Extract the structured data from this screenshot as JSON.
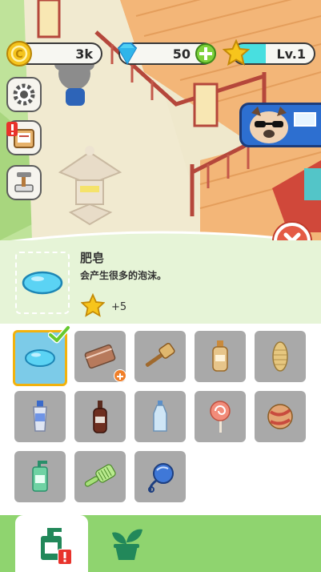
{
  "hud": {
    "coins": "3k",
    "gems": "50",
    "level": "Lv.1",
    "icons": [
      "coin-icon",
      "diamond-icon",
      "plus-icon",
      "star-icon"
    ]
  },
  "sidebar": {
    "buttons": [
      "settings-gear-icon",
      "task-board-icon",
      "build-hammer-icon"
    ]
  },
  "selected_item": {
    "name": "肥皂",
    "description": "会产生很多的泡沫。",
    "reward": "+5"
  },
  "items": [
    {
      "name": "soap",
      "selected": true
    },
    {
      "name": "towel",
      "badge": "plus"
    },
    {
      "name": "brush"
    },
    {
      "name": "shampoo-bottle"
    },
    {
      "name": "loofah"
    },
    {
      "name": "toothpaste"
    },
    {
      "name": "cola-bottle"
    },
    {
      "name": "water-bottle"
    },
    {
      "name": "lollipop"
    },
    {
      "name": "candy-ball"
    },
    {
      "name": "hand-soap-dispenser"
    },
    {
      "name": "comb"
    },
    {
      "name": "hand-mirror"
    }
  ],
  "tabs": [
    {
      "name": "bath-items-tab",
      "active": true,
      "badge": "!"
    },
    {
      "name": "plant-tab",
      "active": false
    }
  ],
  "colors": {
    "panel_green": "#e6f4d7",
    "tab_green": "#8fd46f",
    "selected_bg": "#7ccbe8",
    "selected_border": "#f2b20d",
    "level_bar": "#48dfe0"
  }
}
